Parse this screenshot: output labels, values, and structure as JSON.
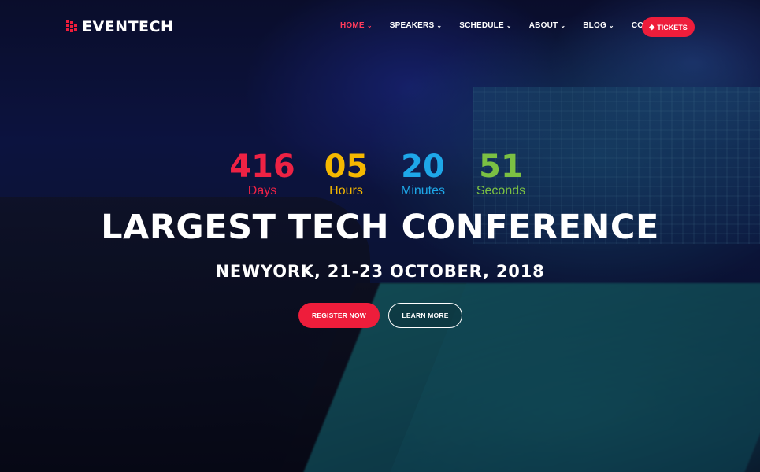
{
  "brand": {
    "name": "EVENTECH",
    "accent": "#ee1d3b"
  },
  "nav": {
    "items": [
      {
        "label": "HOME",
        "has_dropdown": true,
        "active": true
      },
      {
        "label": "SPEAKERS",
        "has_dropdown": true,
        "active": false
      },
      {
        "label": "SCHEDULE",
        "has_dropdown": true,
        "active": false
      },
      {
        "label": "ABOUT",
        "has_dropdown": true,
        "active": false
      },
      {
        "label": "BLOG",
        "has_dropdown": true,
        "active": false
      },
      {
        "label": "CONTACT",
        "has_dropdown": false,
        "active": false
      }
    ],
    "tickets_label": "TICKETS",
    "tickets_icon": "ticket-icon",
    "dropdown_icon": "chevron-down-icon"
  },
  "countdown": [
    {
      "value": "416",
      "label": "Days",
      "color": "#ee2244"
    },
    {
      "value": "05",
      "label": "Hours",
      "color": "#f5b800"
    },
    {
      "value": "20",
      "label": "Minutes",
      "color": "#1ea7e8"
    },
    {
      "value": "51",
      "label": "Seconds",
      "color": "#7bc043"
    }
  ],
  "hero": {
    "headline": "LARGEST TECH CONFERENCE",
    "subline": "NEWYORK, 21-23 OCTOBER, 2018",
    "register_label": "REGISTER NOW",
    "learn_more_label": "LEARN MORE"
  }
}
